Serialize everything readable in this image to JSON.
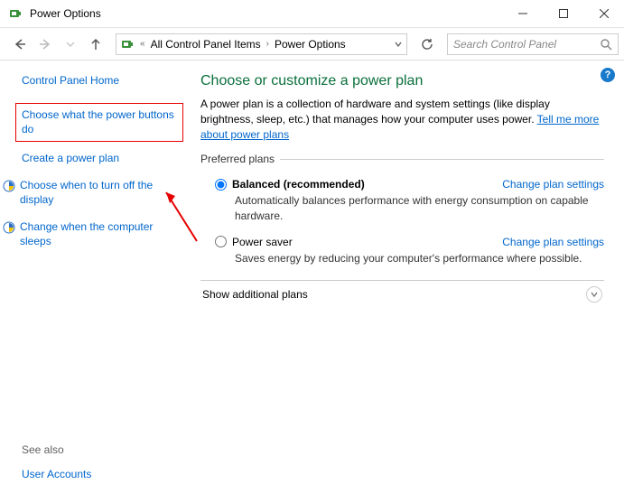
{
  "window": {
    "title": "Power Options"
  },
  "breadcrumbs": {
    "seg1": "All Control Panel Items",
    "seg2": "Power Options"
  },
  "search": {
    "placeholder": "Search Control Panel"
  },
  "help": {
    "glyph": "?"
  },
  "sidebar": {
    "home": "Control Panel Home",
    "link_buttons": "Choose what the power buttons do",
    "link_create": "Create a power plan",
    "link_turnoff": "Choose when to turn off the display",
    "link_sleep": "Change when the computer sleeps"
  },
  "see_also": {
    "label": "See also",
    "link_accounts": "User Accounts"
  },
  "main": {
    "heading": "Choose or customize a power plan",
    "intro_pre": "A power plan is a collection of hardware and system settings (like display brightness, sleep, etc.) that manages how your computer uses power. ",
    "intro_link": "Tell me more about power plans",
    "preferred_legend": "Preferred plans",
    "plan_balanced": {
      "label": "Balanced (recommended)",
      "desc": "Automatically balances performance with energy consumption on capable hardware.",
      "change": "Change plan settings"
    },
    "plan_saver": {
      "label": "Power saver",
      "desc": "Saves energy by reducing your computer's performance where possible.",
      "change": "Change plan settings"
    },
    "show_additional": "Show additional plans"
  }
}
